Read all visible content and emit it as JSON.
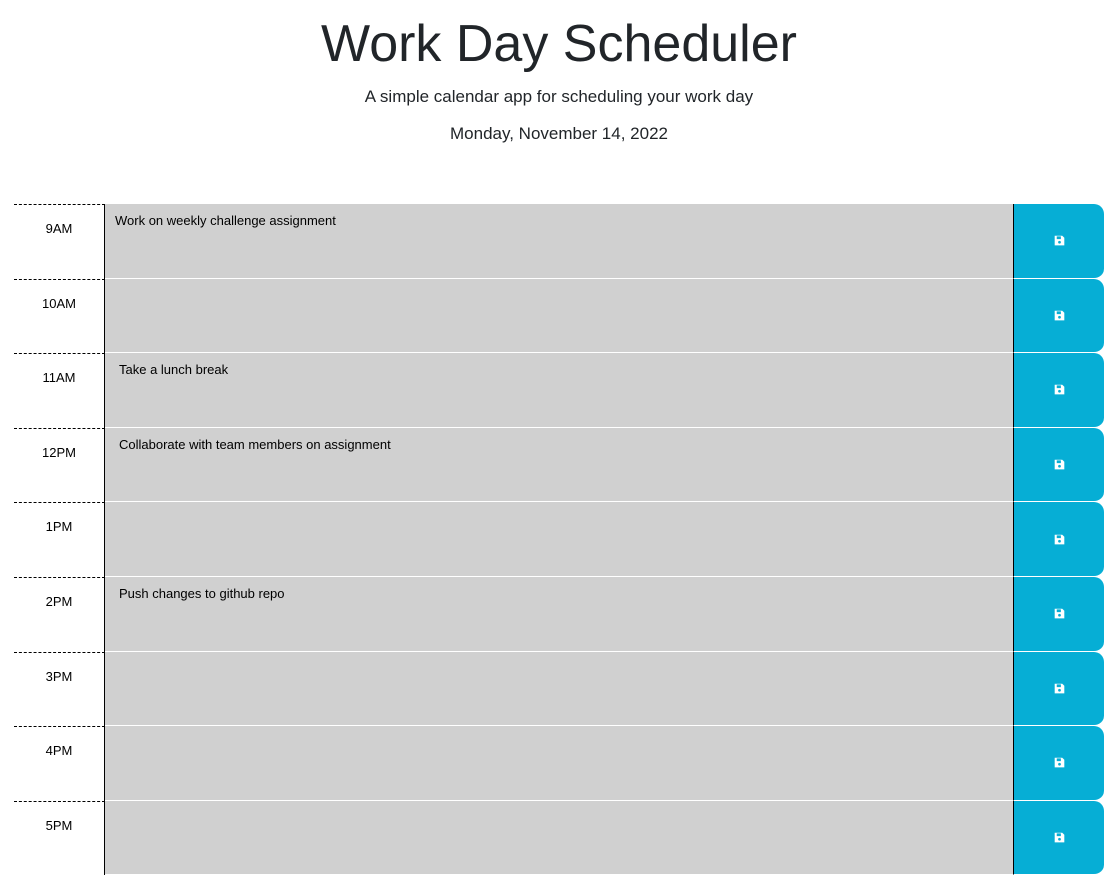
{
  "header": {
    "title": "Work Day Scheduler",
    "subtitle": "A simple calendar app for scheduling your work day",
    "current_day": "Monday, November 14, 2022"
  },
  "colors": {
    "past": "#d3d3d3",
    "save_button": "#06aed5"
  },
  "timeblocks": [
    {
      "hour": "9AM",
      "description": "Work on weekly challenge assignment",
      "save_icon": "floppy-disk-icon"
    },
    {
      "hour": "10AM",
      "description": "",
      "save_icon": "floppy-disk-icon"
    },
    {
      "hour": "11AM",
      "description": "Take a lunch break",
      "save_icon": "floppy-disk-icon"
    },
    {
      "hour": "12PM",
      "description": "Collaborate with team members on assignment",
      "save_icon": "floppy-disk-icon"
    },
    {
      "hour": "1PM",
      "description": "",
      "save_icon": "floppy-disk-icon"
    },
    {
      "hour": "2PM",
      "description": "Push changes to github repo",
      "save_icon": "floppy-disk-icon"
    },
    {
      "hour": "3PM",
      "description": "",
      "save_icon": "floppy-disk-icon"
    },
    {
      "hour": "4PM",
      "description": "",
      "save_icon": "floppy-disk-icon"
    },
    {
      "hour": "5PM",
      "description": "",
      "save_icon": "floppy-disk-icon"
    }
  ]
}
